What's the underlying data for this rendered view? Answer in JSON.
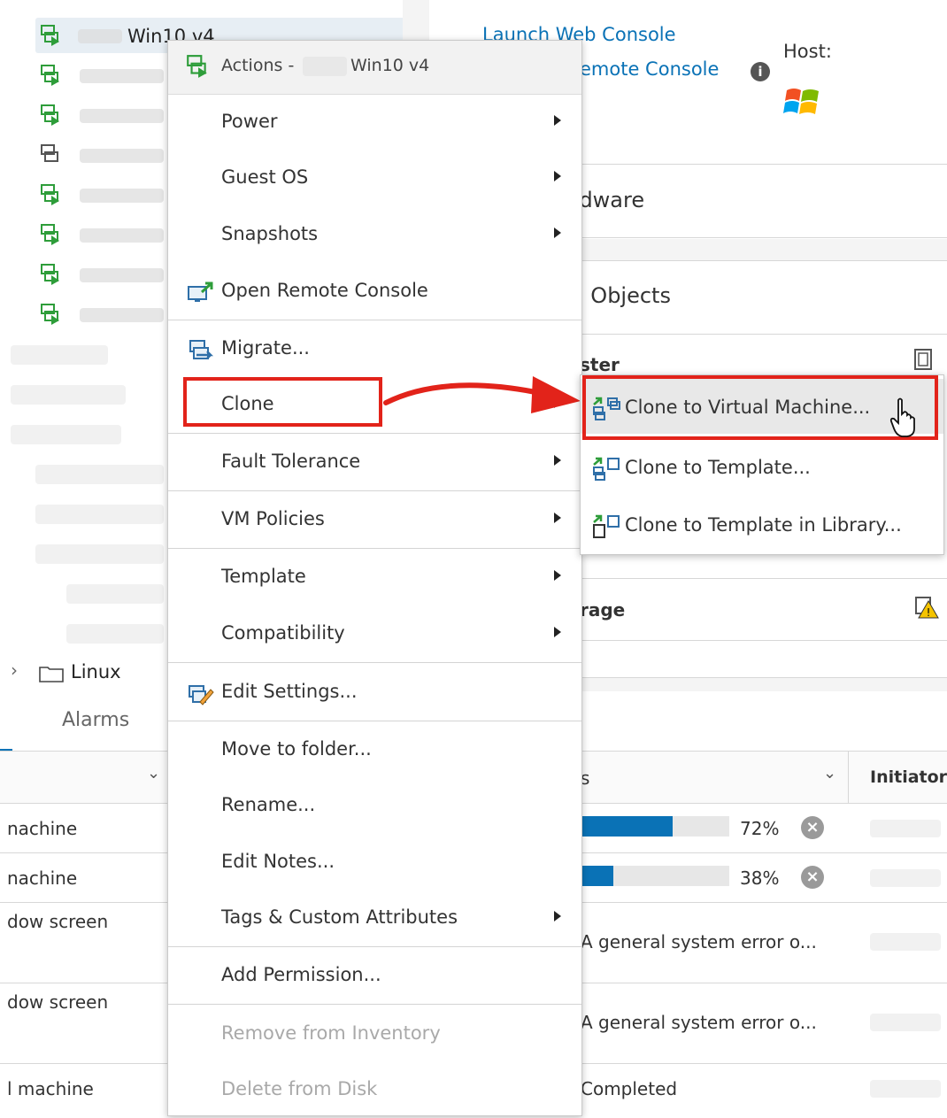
{
  "vm_tree": {
    "selected_vm": "Win10 v4",
    "folder_label": "Linux"
  },
  "summary": {
    "launch_web_console": "Launch Web Console",
    "launch_remote_console_partial": "emote Console",
    "host_label": "Host:",
    "hardware_partial": "rdware",
    "related_objects_partial": "l Objects",
    "cluster_partial": "ster",
    "storage_partial": "rage"
  },
  "bottom_tabs": {
    "alarms": "Alarms"
  },
  "tasks_table": {
    "initiator_header": "Initiator",
    "status_header_partial": "s",
    "rows": [
      {
        "target": "nachine",
        "progress_pct": 72,
        "progress_text": "72%"
      },
      {
        "target": "nachine",
        "progress_pct": 38,
        "progress_text": "38%"
      },
      {
        "target": "dow screen",
        "status": "A general system error o..."
      },
      {
        "target": "dow screen",
        "status": "A general system error o..."
      },
      {
        "target": "l machine",
        "status": "Completed"
      }
    ]
  },
  "actions_menu": {
    "header_prefix": "Actions -",
    "header_vm": "Win10 v4",
    "items": [
      {
        "label": "Power",
        "submenu": true
      },
      {
        "label": "Guest OS",
        "submenu": true
      },
      {
        "label": "Snapshots",
        "submenu": true
      },
      {
        "label": "Open Remote Console",
        "icon": "remote-console-icon"
      },
      {
        "label": "Migrate...",
        "icon": "migrate-icon"
      },
      {
        "label": "Clone",
        "submenu": true,
        "highlighted": true
      },
      {
        "label": "Fault Tolerance",
        "submenu": true
      },
      {
        "label": "VM Policies",
        "submenu": true
      },
      {
        "label": "Template",
        "submenu": true
      },
      {
        "label": "Compatibility",
        "submenu": true
      },
      {
        "label": "Edit Settings...",
        "icon": "edit-settings-icon"
      },
      {
        "label": "Move to folder..."
      },
      {
        "label": "Rename..."
      },
      {
        "label": "Edit Notes..."
      },
      {
        "label": "Tags & Custom Attributes",
        "submenu": true
      },
      {
        "label": "Add Permission..."
      },
      {
        "label": "Remove from Inventory",
        "disabled": true
      },
      {
        "label": "Delete from Disk",
        "disabled": true
      }
    ]
  },
  "clone_submenu": {
    "items": [
      {
        "label": "Clone to Virtual Machine...",
        "highlighted": true
      },
      {
        "label": "Clone to Template..."
      },
      {
        "label": "Clone to Template in Library..."
      }
    ]
  },
  "colors": {
    "accent_blue": "#0a72b6",
    "vm_icon_green": "#2e9d3a",
    "highlight_red": "#e2231a"
  }
}
